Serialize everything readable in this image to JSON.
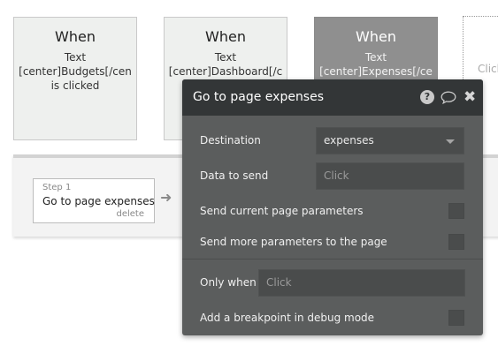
{
  "events": [
    {
      "when": "When",
      "desc": "Text\n[center]Budgets[/cen\nis clicked"
    },
    {
      "when": "When",
      "desc": "Text\n[center]Dashboard[/c"
    },
    {
      "when": "When",
      "desc": "Text\n[center]Expenses[/ce"
    }
  ],
  "new_event": {
    "placeholder": "Click"
  },
  "workflow": {
    "step": {
      "num": "Step 1",
      "title": "Go to page expenses",
      "delete": "delete"
    }
  },
  "panel": {
    "title": "Go to page expenses",
    "help_glyph": "?",
    "close_glyph": "✖",
    "destination": {
      "label": "Destination",
      "value": "expenses"
    },
    "data_to_send": {
      "label": "Data to send",
      "placeholder": "Click"
    },
    "send_current": {
      "label": "Send current page parameters",
      "checked": false
    },
    "send_more": {
      "label": "Send more parameters to the page",
      "checked": false
    },
    "only_when": {
      "label": "Only when",
      "placeholder": "Click"
    },
    "breakpoint": {
      "label": "Add a breakpoint in debug mode",
      "checked": false
    }
  },
  "colors": {
    "panel_bg": "#5b5d5d",
    "panel_header": "#333637",
    "selected_event": "#8f8f8f"
  }
}
